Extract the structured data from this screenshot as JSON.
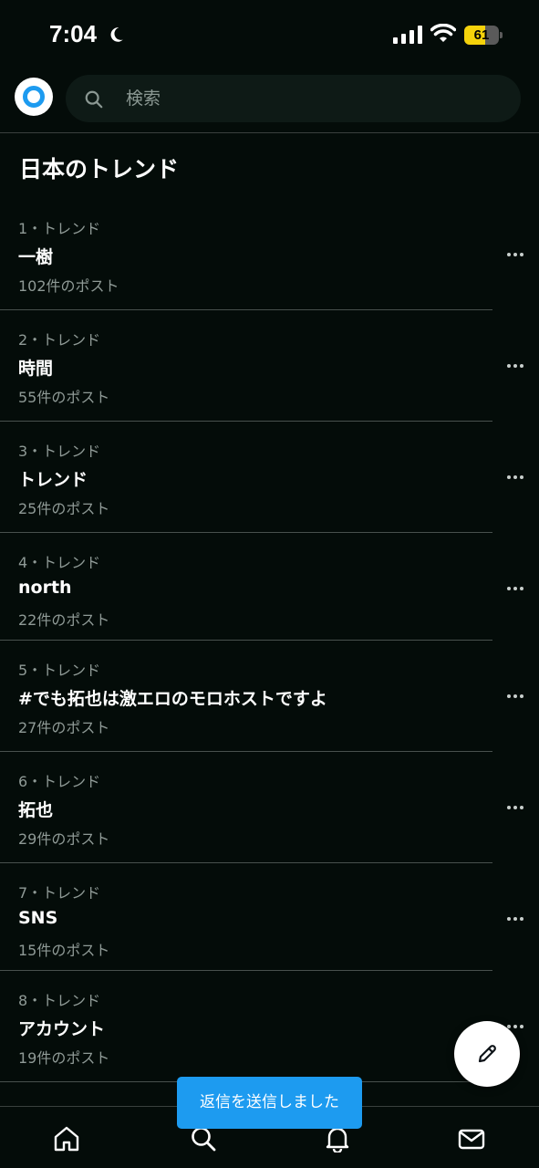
{
  "status_bar": {
    "time": "7:04",
    "battery_level": "61",
    "battery_fraction": 0.61,
    "icons": [
      "moon-icon",
      "signal-icon",
      "wifi-icon",
      "battery-icon"
    ]
  },
  "header": {
    "logo": "app-logo",
    "search": {
      "placeholder": "検索",
      "value": ""
    }
  },
  "section": {
    "title": "日本のトレンド"
  },
  "trends": [
    {
      "meta": "1・トレンド",
      "name": "一樹",
      "count": "102件のポスト"
    },
    {
      "meta": "2・トレンド",
      "name": "時間",
      "count": "55件のポスト"
    },
    {
      "meta": "3・トレンド",
      "name": "トレンド",
      "count": "25件のポスト"
    },
    {
      "meta": "4・トレンド",
      "name": "north",
      "count": "22件のポスト"
    },
    {
      "meta": "5・トレンド",
      "name": "#でも拓也は激エロのモロホストですよ",
      "count": "27件のポスト"
    },
    {
      "meta": "6・トレンド",
      "name": "拓也",
      "count": "29件のポスト"
    },
    {
      "meta": "7・トレンド",
      "name": "SNS",
      "count": "15件のポスト"
    },
    {
      "meta": "8・トレンド",
      "name": "アカウント",
      "count": "19件のポスト"
    }
  ],
  "toast": {
    "text": "返信を送信しました"
  },
  "bottom_nav": {
    "items": [
      "home-icon",
      "search-icon",
      "notifications-icon",
      "messages-icon"
    ]
  },
  "colors": {
    "background": "#040c09",
    "accent": "#1d9bf0",
    "battery": "#f5d20b",
    "secondary_text": "#8f9a96"
  }
}
